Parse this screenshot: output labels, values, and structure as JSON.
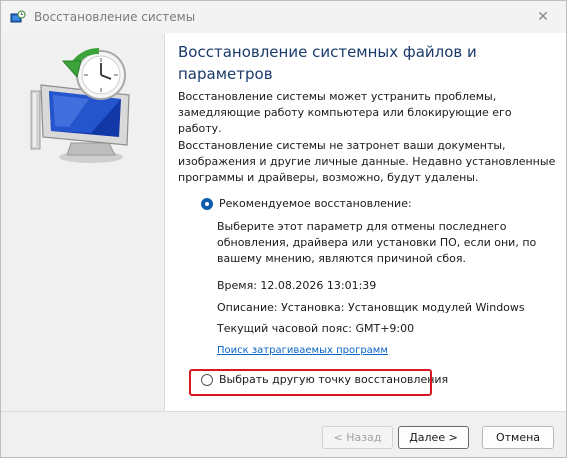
{
  "window": {
    "title": "Восстановление системы",
    "close_symbol": "✕"
  },
  "main": {
    "heading": "Восстановление системных файлов и параметров",
    "para1": "Восстановление системы может устранить проблемы, замедляющие работу компьютера или блокирующие его работу.",
    "para2": "Восстановление системы не затронет ваши документы, изображения и другие личные данные. Недавно установленные программы и драйверы, возможно, будут удалены."
  },
  "options": {
    "recommended": {
      "label": "Рекомендуемое восстановление:",
      "selected": true,
      "description": "Выберите этот параметр для отмены последнего обновления, драйвера или установки ПО, если они, по вашему мнению, являются причиной сбоя.",
      "time": "Время: 12.08.2026 13:01:39",
      "description_line": "Описание: Установка: Установщик модулей Windows",
      "timezone": "Текущий часовой пояс: GMT+9:00",
      "link": "Поиск затрагиваемых программ"
    },
    "other": {
      "label": "Выбрать другую точку восстановления",
      "selected": false
    }
  },
  "buttons": {
    "back": "< Назад",
    "next": "Далее >",
    "cancel": "Отмена"
  },
  "colors": {
    "heading": "#1b3a6b",
    "link": "#0a64c8",
    "radio_selected": "#0b5cad",
    "highlight": "#d7191f"
  },
  "icons": {
    "title": "system-restore-icon",
    "illustration": "monitor-clock-restore-icon"
  }
}
